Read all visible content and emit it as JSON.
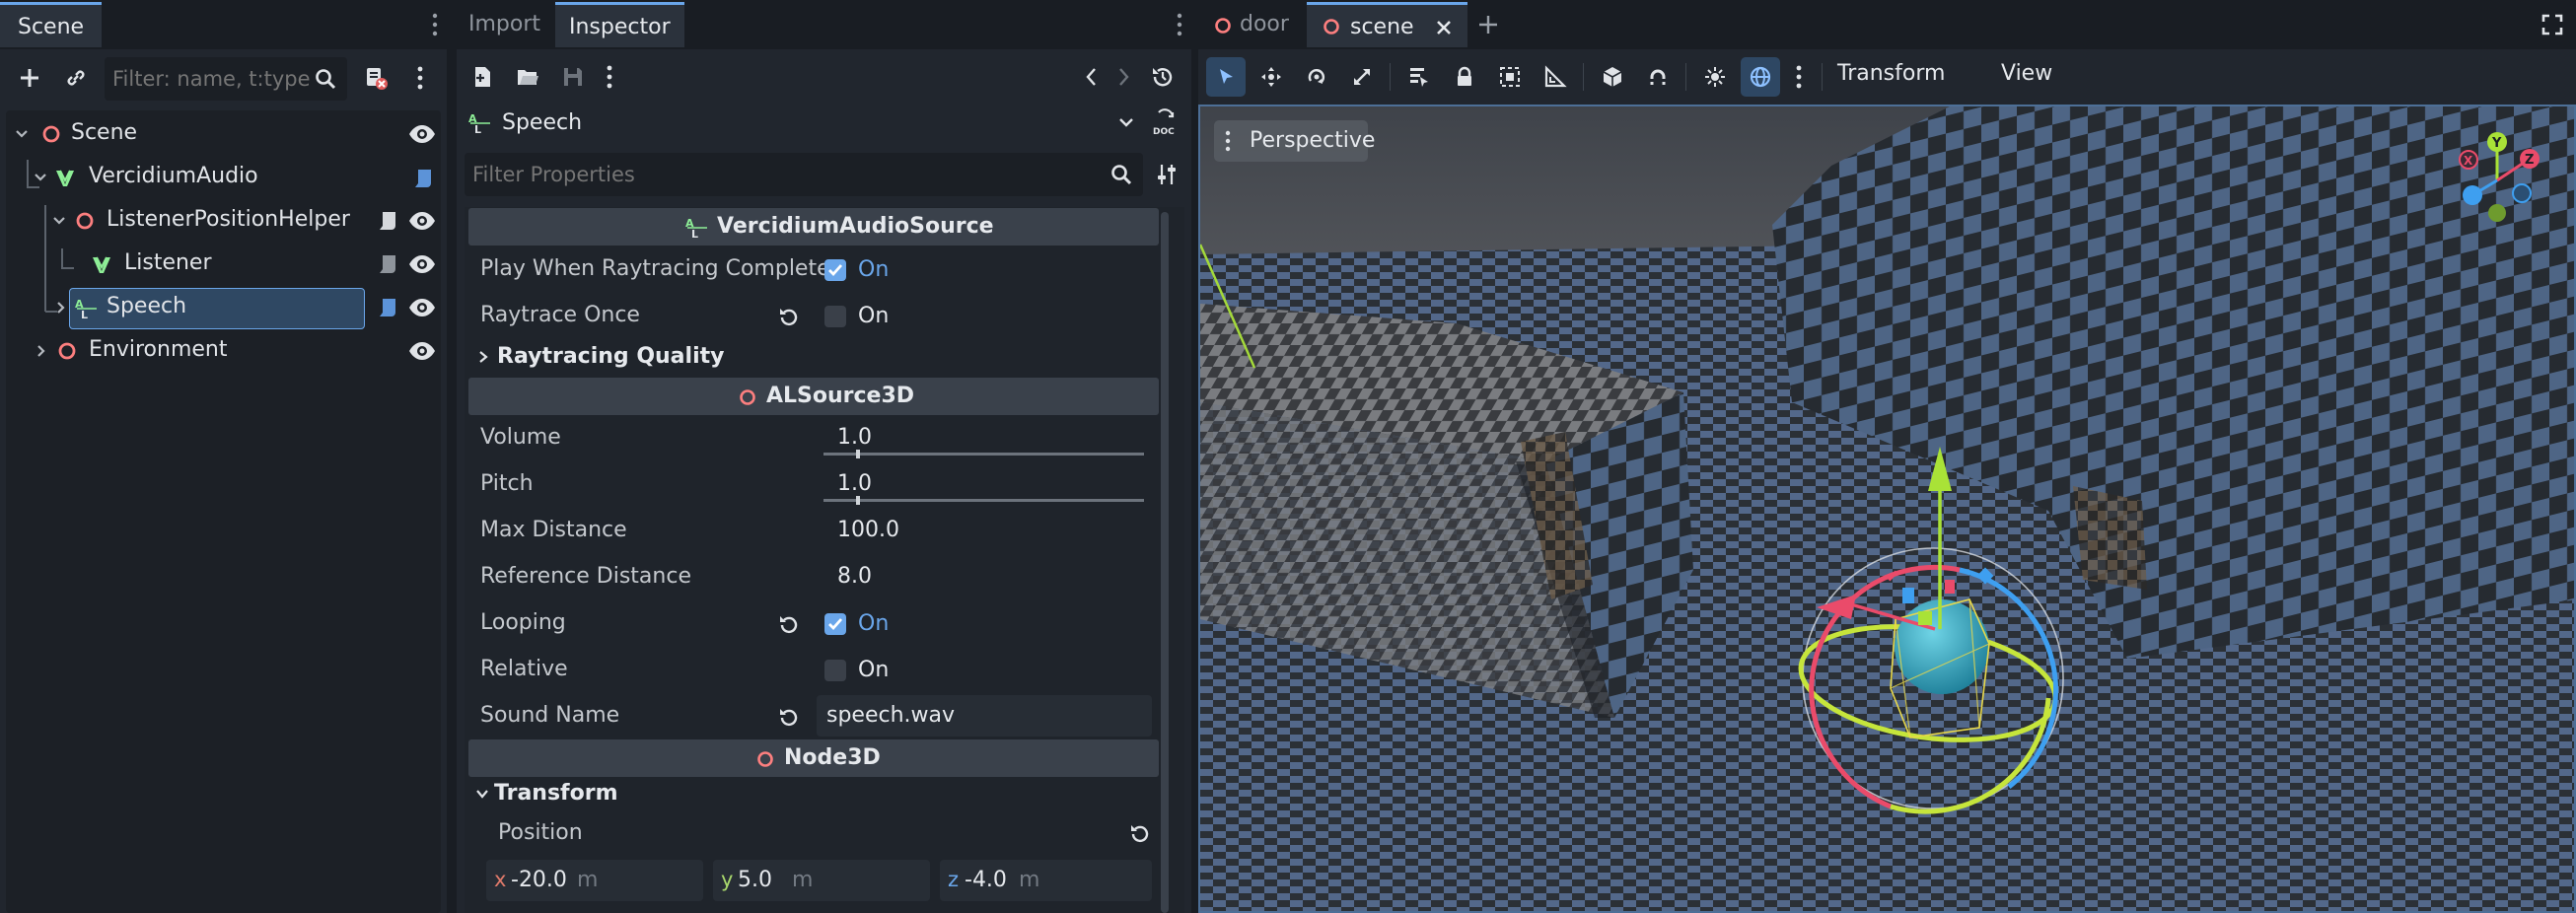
{
  "scene_dock": {
    "tab": "Scene",
    "filter_placeholder": "Filter: name, t:type, g:group",
    "tree": [
      {
        "label": "Scene"
      },
      {
        "label": "VercidiumAudio"
      },
      {
        "label": "ListenerPositionHelper"
      },
      {
        "label": "Listener"
      },
      {
        "label": "Speech"
      },
      {
        "label": "Environment"
      }
    ]
  },
  "inspector": {
    "tabs": [
      "Import",
      "Inspector"
    ],
    "active_tab": "Inspector",
    "object_name": "Speech",
    "filter_placeholder": "Filter Properties",
    "sections": {
      "vercidium": "VercidiumAudioSource",
      "alsource": "ALSource3D",
      "node3d": "Node3D",
      "raytracing_quality": "Raytracing Quality",
      "transform": "Transform"
    },
    "props": {
      "play_when": {
        "label": "Play When Raytracing Completes",
        "value": "On",
        "checked": true
      },
      "raytrace_once": {
        "label": "Raytrace Once",
        "value": "On",
        "checked": false
      },
      "volume": {
        "label": "Volume",
        "value": "1.0",
        "fraction": 0.1
      },
      "pitch": {
        "label": "Pitch",
        "value": "1.0",
        "fraction": 0.1
      },
      "max_distance": {
        "label": "Max Distance",
        "value": "100.0"
      },
      "reference_distance": {
        "label": "Reference Distance",
        "value": "8.0"
      },
      "looping": {
        "label": "Looping",
        "value": "On",
        "checked": true
      },
      "relative": {
        "label": "Relative",
        "value": "On",
        "checked": false
      },
      "sound_name": {
        "label": "Sound Name",
        "value": "speech.wav"
      }
    },
    "position": {
      "label": "Position",
      "x_axis": "x",
      "x": "-20.0",
      "y_axis": "y",
      "y": "5.0",
      "z_axis": "z",
      "z": "-4.0",
      "unit": "m"
    }
  },
  "viewport": {
    "tabs": [
      "door",
      "scene"
    ],
    "active_tab": "scene",
    "menus": {
      "transform": "Transform",
      "view": "View"
    },
    "perspective_label": "Perspective"
  },
  "colors": {
    "accent": "#6aa6ea",
    "node3d_red": "#fc7f7f",
    "audio_green": "#8eef97",
    "panel_bg": "#21262e"
  }
}
